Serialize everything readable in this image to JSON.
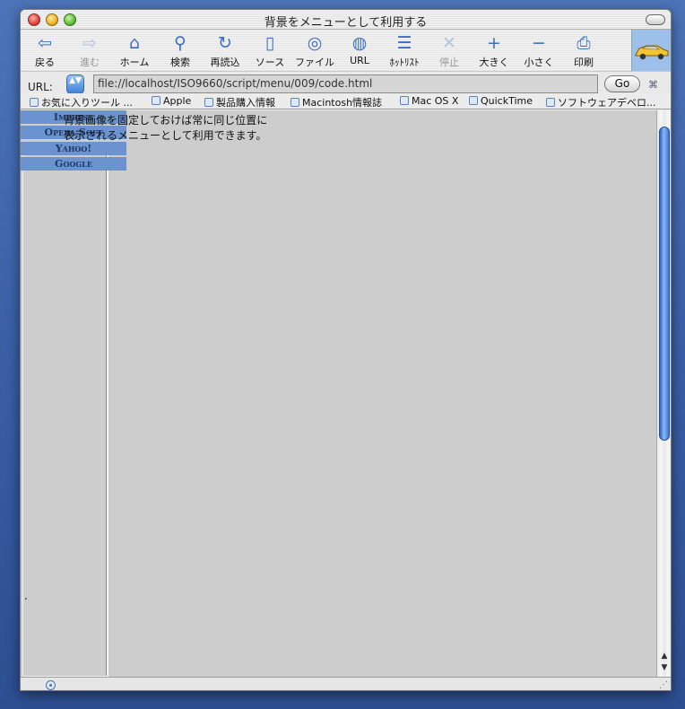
{
  "window": {
    "title": "背景をメニューとして利用する"
  },
  "toolbar": {
    "buttons": [
      {
        "label": "戻る",
        "icon": "back-arrow-icon",
        "glyph": "⇦",
        "enabled": true
      },
      {
        "label": "進む",
        "icon": "forward-arrow-icon",
        "glyph": "⇨",
        "enabled": false
      },
      {
        "label": "ホーム",
        "icon": "home-icon",
        "glyph": "⌂",
        "enabled": true
      },
      {
        "label": "検索",
        "icon": "magnifier-icon",
        "glyph": "⚲",
        "enabled": true
      },
      {
        "label": "再読込",
        "icon": "reload-icon",
        "glyph": "↻",
        "enabled": true
      },
      {
        "label": "ソース",
        "icon": "source-document-icon",
        "glyph": "▯",
        "enabled": true
      },
      {
        "label": "ファイル",
        "icon": "file-disc-icon",
        "glyph": "◎",
        "enabled": true
      },
      {
        "label": "URL",
        "icon": "url-icon",
        "glyph": "◍",
        "enabled": true
      },
      {
        "label": "ﾎｯﾄﾘｽﾄ",
        "icon": "hotlist-icon",
        "glyph": "☰",
        "enabled": true
      },
      {
        "label": "停止",
        "icon": "stop-icon",
        "glyph": "✕",
        "enabled": false
      },
      {
        "label": "大きく",
        "icon": "text-bigger-icon",
        "glyph": "+",
        "enabled": true
      },
      {
        "label": "小さく",
        "icon": "text-smaller-icon",
        "glyph": "−",
        "enabled": true
      },
      {
        "label": "印刷",
        "icon": "print-icon",
        "glyph": "⎙",
        "enabled": true
      }
    ]
  },
  "urlbar": {
    "label": "URL:",
    "value": "file://localhost/ISO9660/script/menu/009/code.html",
    "go_label": "Go",
    "stepper_glyph": "▲▼"
  },
  "favorites": [
    "お気に入りツール ...",
    "Apple",
    "製品購入情報",
    "Macintosh情報誌",
    "Mac OS X",
    "QuickTime",
    "ソフトウェアデベロ..."
  ],
  "content": {
    "lines": [
      "背景画像を固定しておけば常に同じ位置に",
      "表示されるメニューとして利用できます。"
    ],
    "menu_items": [
      "Impress",
      "Opera Soft",
      "Yahoo!",
      "Google"
    ],
    "stray_dot": "."
  },
  "colors": {
    "menu_bg": "#6b93cf",
    "content_bg": "#cdcdcd",
    "accent": "#3d6fc0"
  }
}
